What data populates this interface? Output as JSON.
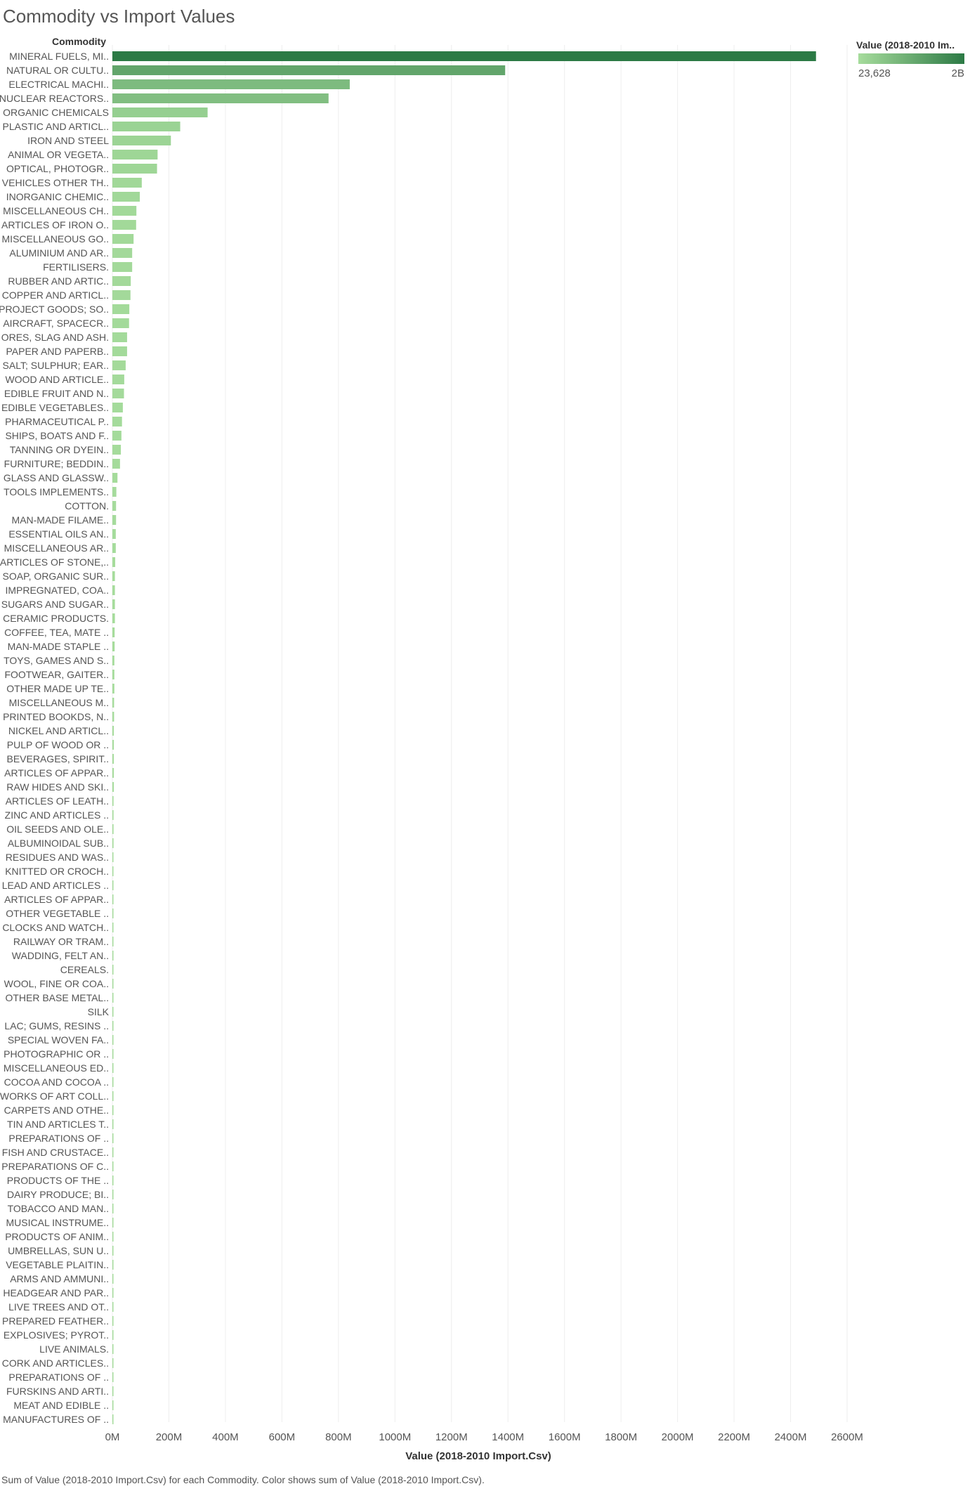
{
  "chart_data": {
    "type": "bar",
    "orientation": "horizontal",
    "title": "Commodity vs Import Values",
    "row_header": "Commodity",
    "xlabel": "Value (2018-2010 Import.Csv)",
    "xlim": [
      0,
      2600
    ],
    "x_unit": "M",
    "x_ticks": [
      "0M",
      "200M",
      "400M",
      "600M",
      "800M",
      "1000M",
      "1200M",
      "1400M",
      "1600M",
      "1800M",
      "2000M",
      "2200M",
      "2400M",
      "2600M"
    ],
    "grid": true,
    "legend_placement": "top-right",
    "legend": {
      "title": "Value (2018-2010 Im..",
      "min_label": "23,628",
      "max_label": "2B",
      "color_low": "#a6dc9c",
      "color_high": "#2c7a45"
    },
    "caption": "Sum of Value (2018-2010 Import.Csv) for each Commodity.  Color shows sum of Value (2018-2010 Import.Csv).",
    "categories": [
      "MINERAL FUELS, MI..",
      "NATURAL OR CULTU..",
      "ELECTRICAL MACHI..",
      "NUCLEAR REACTORS..",
      "ORGANIC CHEMICALS",
      "PLASTIC AND ARTICL..",
      "IRON AND STEEL",
      "ANIMAL OR VEGETA..",
      "OPTICAL, PHOTOGR..",
      "VEHICLES OTHER TH..",
      "INORGANIC CHEMIC..",
      "MISCELLANEOUS CH..",
      "ARTICLES OF IRON O..",
      "MISCELLANEOUS GO..",
      "ALUMINIUM AND AR..",
      "FERTILISERS.",
      "RUBBER AND ARTIC..",
      "COPPER AND ARTICL..",
      "PROJECT GOODS; SO..",
      "AIRCRAFT, SPACECR..",
      "ORES, SLAG AND ASH.",
      "PAPER AND PAPERB..",
      "SALT; SULPHUR; EAR..",
      "WOOD AND ARTICLE..",
      "EDIBLE FRUIT AND N..",
      "EDIBLE VEGETABLES..",
      "PHARMACEUTICAL P..",
      "SHIPS, BOATS AND F..",
      "TANNING OR DYEIN..",
      "FURNITURE; BEDDIN..",
      "GLASS AND GLASSW..",
      "TOOLS IMPLEMENTS..",
      "COTTON.",
      "MAN-MADE FILAME..",
      "ESSENTIAL OILS AN..",
      "MISCELLANEOUS AR..",
      "ARTICLES OF STONE,..",
      "SOAP, ORGANIC SUR..",
      "IMPREGNATED, COA..",
      "SUGARS AND SUGAR..",
      "CERAMIC PRODUCTS.",
      "COFFEE, TEA, MATE ..",
      "MAN-MADE STAPLE ..",
      "TOYS, GAMES AND S..",
      "FOOTWEAR, GAITER..",
      "OTHER MADE UP TE..",
      "MISCELLANEOUS M..",
      "PRINTED BOOKDS, N..",
      "NICKEL AND ARTICL..",
      "PULP OF WOOD OR ..",
      "BEVERAGES, SPIRIT..",
      "ARTICLES OF APPAR..",
      "RAW HIDES AND SKI..",
      "ARTICLES OF LEATH..",
      "ZINC AND ARTICLES ..",
      "OIL SEEDS AND OLE..",
      "ALBUMINOIDAL SUB..",
      "RESIDUES AND WAS..",
      "KNITTED OR CROCH..",
      "LEAD AND ARTICLES ..",
      "ARTICLES OF APPAR..",
      "OTHER VEGETABLE ..",
      "CLOCKS AND WATCH..",
      "RAILWAY OR TRAM..",
      "WADDING, FELT AN..",
      "CEREALS.",
      "WOOL, FINE OR COA..",
      "OTHER BASE METAL..",
      "SILK",
      "LAC; GUMS, RESINS ..",
      "SPECIAL WOVEN FA..",
      "PHOTOGRAPHIC OR ..",
      "MISCELLANEOUS ED..",
      "COCOA AND COCOA ..",
      "WORKS OF ART COLL..",
      "CARPETS AND OTHE..",
      "TIN AND ARTICLES T..",
      "PREPARATIONS OF ..",
      "FISH AND CRUSTACE..",
      "PREPARATIONS OF C..",
      "PRODUCTS OF THE ..",
      "DAIRY PRODUCE; BI..",
      "TOBACCO AND MAN..",
      "MUSICAL INSTRUME..",
      "PRODUCTS OF ANIM..",
      "UMBRELLAS, SUN U..",
      "VEGETABLE PLAITIN..",
      "ARMS AND AMMUNI..",
      "HEADGEAR AND PAR..",
      "LIVE TREES AND OT..",
      "PREPARED FEATHER..",
      "EXPLOSIVES; PYROT..",
      "LIVE ANIMALS.",
      "CORK AND ARTICLES..",
      "PREPARATIONS OF ..",
      "FURSKINS AND ARTI..",
      "MEAT AND EDIBLE ..",
      "MANUFACTURES OF .."
    ],
    "values": [
      2490,
      1390,
      840,
      765,
      337,
      240,
      207,
      160,
      158,
      104,
      97,
      85,
      84,
      75,
      70,
      70,
      65,
      64,
      60,
      59,
      52,
      52,
      47,
      42,
      41,
      37,
      34,
      32,
      30,
      27,
      18,
      14,
      13,
      13,
      12,
      12,
      10,
      9,
      9,
      9,
      9,
      8,
      8,
      7,
      7,
      7,
      6,
      6,
      5,
      5,
      5,
      5,
      5,
      4,
      4,
      4,
      4,
      3,
      3,
      3,
      3,
      3,
      3,
      2,
      2,
      2,
      2,
      1,
      0.7,
      0.6,
      0.5,
      0.5,
      0.4,
      0.4,
      0.4,
      0.3,
      0.3,
      0.3,
      0.3,
      0.3,
      0.2,
      0.2,
      0.2,
      0.2,
      0.2,
      0.1,
      0.1,
      0.1,
      0.1,
      0.1,
      0.1,
      0.1,
      0.1,
      0.05,
      0.05,
      0.05,
      0.03,
      0.02
    ]
  }
}
